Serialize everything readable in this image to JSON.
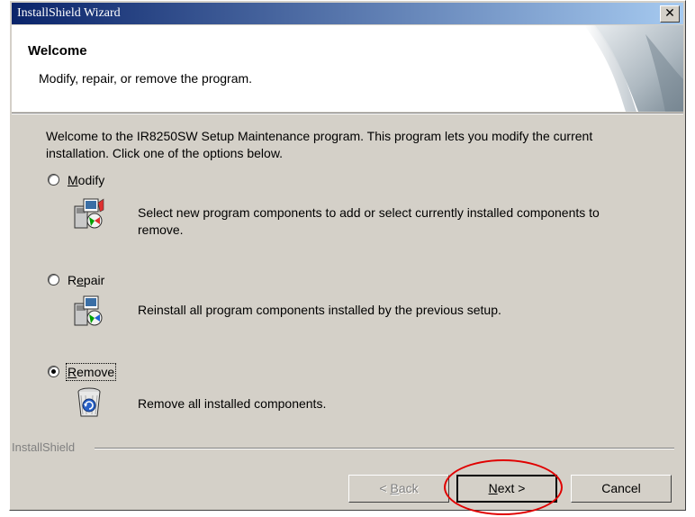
{
  "window": {
    "title": "InstallShield Wizard",
    "close_glyph": "✕"
  },
  "header": {
    "title": "Welcome",
    "subtitle": "Modify, repair, or remove the program."
  },
  "intro": "Welcome to the IR8250SW Setup Maintenance program. This program lets you modify the current installation. Click one of the options below.",
  "options": [
    {
      "label_pre": "",
      "label_mnemonic": "M",
      "label_post": "odify",
      "description": "Select new program components to add or select currently installed components to remove.",
      "selected": false,
      "icon": "modify-components-icon"
    },
    {
      "label_pre": "R",
      "label_mnemonic": "e",
      "label_post": "pair",
      "description": "Reinstall all program components installed by the previous setup.",
      "selected": false,
      "icon": "repair-components-icon"
    },
    {
      "label_pre": "",
      "label_mnemonic": "R",
      "label_post": "emove",
      "description": "Remove all installed components.",
      "selected": true,
      "icon": "recycle-bin-icon"
    }
  ],
  "brand": "InstallShield",
  "buttons": {
    "back_pre": "< ",
    "back_mnemonic": "B",
    "back_post": "ack",
    "next_mnemonic": "N",
    "next_post": "ext >",
    "cancel": "Cancel"
  },
  "colors": {
    "title_gradient_start": "#0a246a",
    "title_gradient_end": "#a6caf0",
    "dialog_face": "#d4d0c8",
    "annotation_oval": "#e00000"
  }
}
